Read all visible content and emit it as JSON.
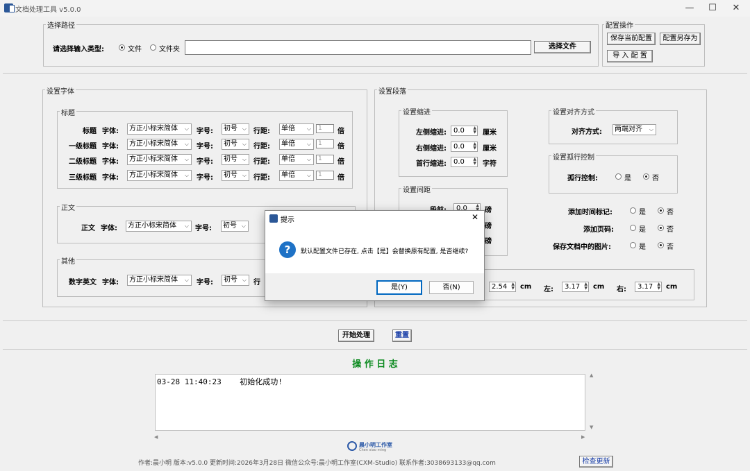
{
  "window": {
    "title": "文档处理工具 v5.0.0",
    "min": "—",
    "max": "☐",
    "close": "✕"
  },
  "path": {
    "group": "选择路径",
    "label": "请选择输入类型:",
    "opt_file": "文件",
    "opt_folder": "文件夹",
    "value": "",
    "select_btn": "选择文件"
  },
  "config": {
    "group": "配置操作",
    "save": "保存当前配置",
    "save_as": "配置另存为",
    "import": "导 入 配 置"
  },
  "font": {
    "group": "设置字体",
    "heading_group": "标题",
    "body_group": "正文",
    "other_group": "其他",
    "font_label": "字体:",
    "size_label": "字号:",
    "spacing_label": "行距:",
    "times": "倍",
    "multiple_value": "1",
    "rows": [
      {
        "name": "标题",
        "font": "方正小标宋简体",
        "size": "初号",
        "spacing": "单倍"
      },
      {
        "name": "一级标题",
        "font": "方正小标宋简体",
        "size": "初号",
        "spacing": "单倍"
      },
      {
        "name": "二级标题",
        "font": "方正小标宋简体",
        "size": "初号",
        "spacing": "单倍"
      },
      {
        "name": "三级标题",
        "font": "方正小标宋简体",
        "size": "初号",
        "spacing": "单倍"
      }
    ],
    "body_row": {
      "name": "正文",
      "font": "方正小标宋简体",
      "size": "初号"
    },
    "other_row": {
      "name": "数字英文",
      "font": "方正小标宋简体",
      "size": "初号",
      "spacing_cut": "行"
    }
  },
  "para": {
    "group": "设置段落",
    "indent_group": "设置缩进",
    "indent": [
      {
        "label": "左侧缩进:",
        "value": "0.0",
        "unit": "厘米"
      },
      {
        "label": "右侧缩进:",
        "value": "0.0",
        "unit": "厘米"
      },
      {
        "label": "首行缩进:",
        "value": "0.0",
        "unit": "字符"
      }
    ],
    "spacing_group": "设置间距",
    "spacing": [
      {
        "label": "段前:",
        "value": "0.0",
        "unit": "磅"
      },
      {
        "unit": "磅"
      },
      {
        "unit": "磅"
      }
    ],
    "align_group": "设置对齐方式",
    "align_label": "对齐方式:",
    "align_value": "两端对齐",
    "orphan_group": "设置孤行控制",
    "orphan_label": "孤行控制:",
    "yes": "是",
    "no": "否",
    "timestamp_label": "添加时间标记:",
    "page_num_label": "添加页码:",
    "keep_images_label": "保存文档中的图片:",
    "margin_top_value": "2.54",
    "margin_left_label": "左:",
    "margin_left_value": "3.17",
    "margin_right_label": "右:",
    "margin_right_value": "3.17",
    "cm": "cm"
  },
  "actions": {
    "start": "开始处理",
    "reset": "重置"
  },
  "log": {
    "title": "操 作 日 志",
    "entries": [
      "03-28 11:40:23    初始化成功!"
    ]
  },
  "brand": {
    "name": "晨小明工作室",
    "sub": "Chen xiao ming"
  },
  "footer": {
    "text": "作者:晨小明   版本:v5.0.0   更新时间:2026年3月28日   微信公众号:晨小明工作室(CXM-Studio)   联系作者:3038693133@qq.com",
    "check_update": "检查更新"
  },
  "dialog": {
    "title": "提示",
    "message": "默认配置文件已存在, 点击【是】会替换原有配置, 是否继续?",
    "yes_btn": "是(Y)",
    "no_btn": "否(N)",
    "close": "✕"
  }
}
